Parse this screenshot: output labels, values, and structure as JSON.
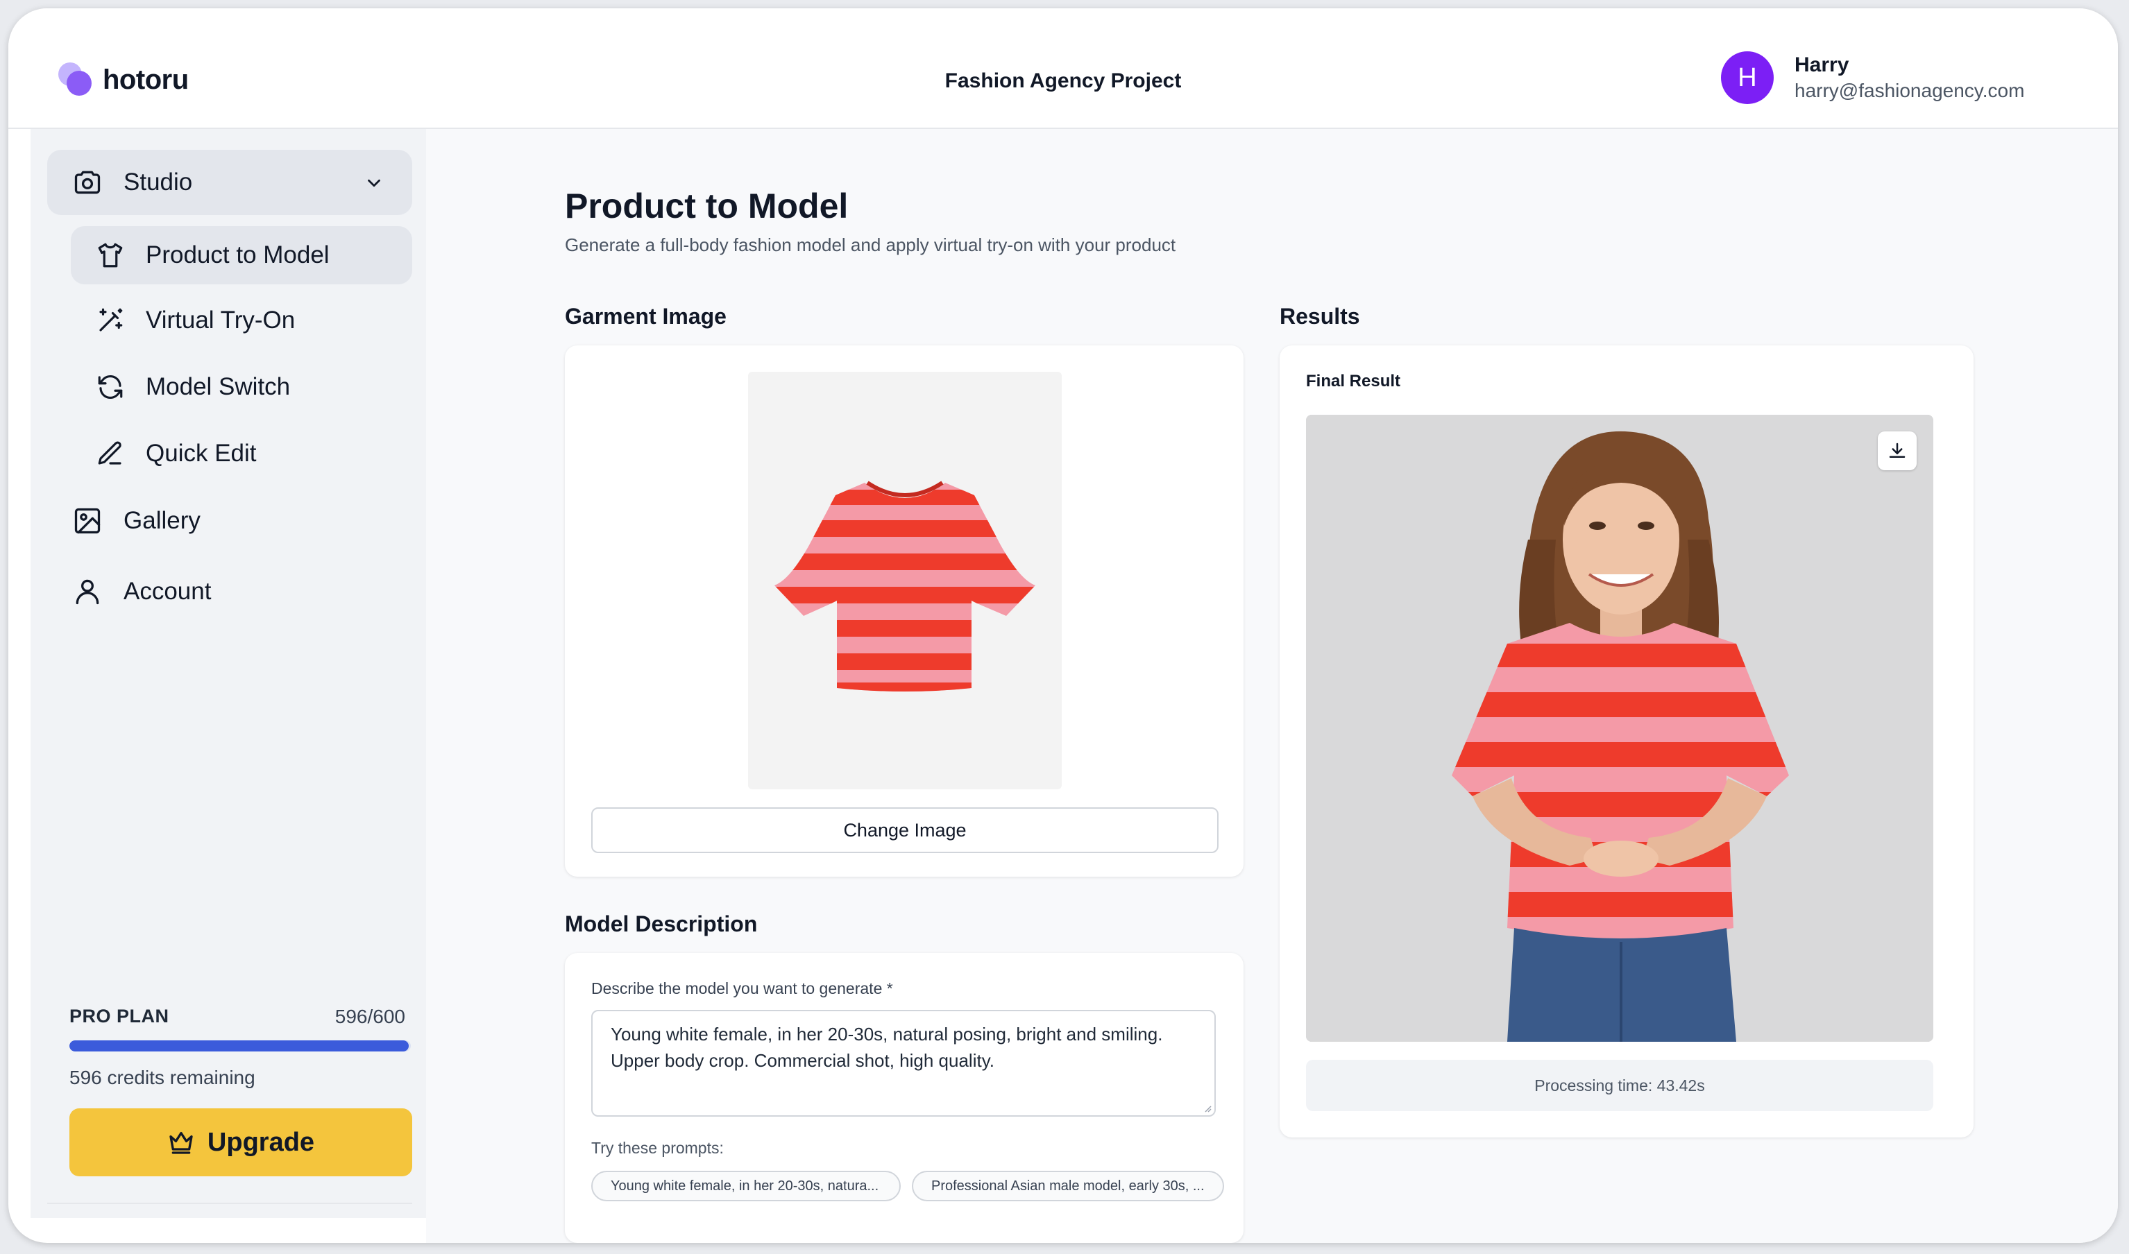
{
  "app": {
    "logo_text": "hotoru",
    "project_title": "Fashion Agency Project",
    "user": {
      "initial": "H",
      "name": "Harry",
      "email": "harry@fashionagency.com"
    }
  },
  "sidebar": {
    "studio_label": "Studio",
    "studio_items": [
      {
        "label": "Product to Model",
        "icon": "shirt-icon",
        "active": true
      },
      {
        "label": "Virtual Try-On",
        "icon": "magic-wand-icon",
        "active": false
      },
      {
        "label": "Model Switch",
        "icon": "refresh-icon",
        "active": false
      },
      {
        "label": "Quick Edit",
        "icon": "pencil-icon",
        "active": false
      }
    ],
    "items": [
      {
        "label": "Gallery",
        "icon": "image-icon"
      },
      {
        "label": "Account",
        "icon": "user-icon"
      }
    ],
    "plan": {
      "name": "PRO PLAN",
      "usage": "596/600",
      "used_fraction": 0.9933,
      "credits_text": "596 credits remaining",
      "upgrade_label": "Upgrade",
      "bar_color": "#3b5bdb",
      "button_color": "#f4c53d"
    }
  },
  "main": {
    "title": "Product to Model",
    "subtitle": "Generate a full-body fashion model and apply virtual try-on with your product",
    "garment": {
      "heading": "Garment Image",
      "change_button": "Change Image"
    },
    "model": {
      "heading": "Model Description",
      "field_label": "Describe the model you want to generate *",
      "description": "Young white female, in her 20-30s, natural posing, bright and smiling. Upper body crop. Commercial shot, high quality.",
      "try_label": "Try these prompts:",
      "prompts": [
        "Young white female, in her 20-30s, natura...",
        "Professional Asian male model, early 30s, ..."
      ]
    },
    "results": {
      "heading": "Results",
      "final_label": "Final Result",
      "processing_time": "Processing time: 43.42s"
    }
  },
  "colors": {
    "accent_purple": "#7c1ff5",
    "stripe_red": "#ee3b2c",
    "stripe_pink": "#f49aa7"
  }
}
